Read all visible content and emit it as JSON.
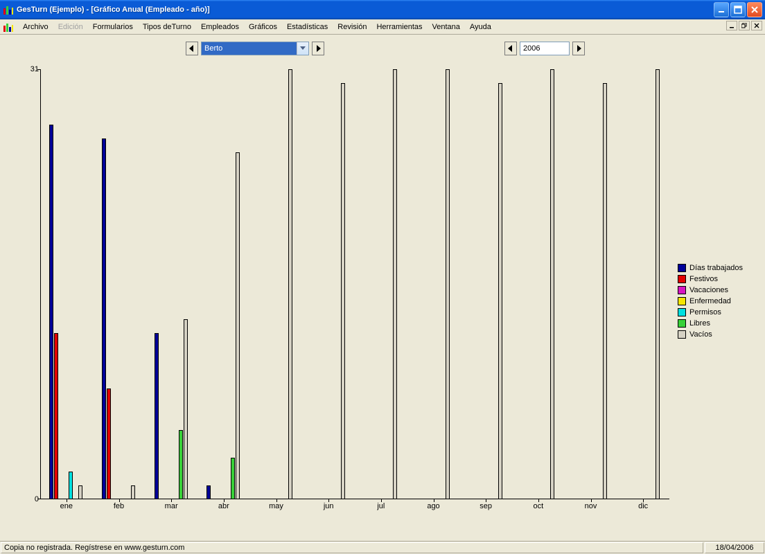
{
  "window": {
    "title": "GesTurn (Ejemplo) - [Gráfico Anual  (Empleado - año)]"
  },
  "menu": {
    "items": [
      "Archivo",
      "Edición",
      "Formularios",
      "Tipos deTurno",
      "Empleados",
      "Gráficos",
      "Estadísticas",
      "Revisión",
      "Herramientas",
      "Ventana",
      "Ayuda"
    ],
    "disabled_index": 1
  },
  "nav": {
    "employee": "Berto",
    "year": "2006"
  },
  "legend": {
    "items": [
      {
        "label": "Días trabajados",
        "color": "#000099"
      },
      {
        "label": "Festivos",
        "color": "#e30000"
      },
      {
        "label": "Vacaciones",
        "color": "#d815c3"
      },
      {
        "label": "Enfermedad",
        "color": "#f5e600"
      },
      {
        "label": "Permisos",
        "color": "#00e0e0"
      },
      {
        "label": "Libres",
        "color": "#38d138"
      },
      {
        "label": "Vacíos",
        "color": "#d6d2c4"
      }
    ]
  },
  "status": {
    "left": "Copia no registrada. Regístrese en www.gesturn.com",
    "right": "18/04/2006"
  },
  "chart_data": {
    "type": "bar",
    "title": "",
    "xlabel": "",
    "ylabel": "",
    "ylim": [
      0,
      31
    ],
    "yticks": [
      0,
      31
    ],
    "categories": [
      "ene",
      "feb",
      "mar",
      "abr",
      "may",
      "jun",
      "jul",
      "ago",
      "sep",
      "oct",
      "nov",
      "dic"
    ],
    "series": [
      {
        "name": "Días trabajados",
        "color": "#000099",
        "values": [
          27,
          26,
          12,
          1,
          0,
          0,
          0,
          0,
          0,
          0,
          0,
          0
        ]
      },
      {
        "name": "Festivos",
        "color": "#e30000",
        "values": [
          12,
          8,
          0,
          0,
          0,
          0,
          0,
          0,
          0,
          0,
          0,
          0
        ]
      },
      {
        "name": "Vacaciones",
        "color": "#d815c3",
        "values": [
          0,
          0,
          0,
          0,
          0,
          0,
          0,
          0,
          0,
          0,
          0,
          0
        ]
      },
      {
        "name": "Enfermedad",
        "color": "#f5e600",
        "values": [
          0,
          0,
          0,
          0,
          0,
          0,
          0,
          0,
          0,
          0,
          0,
          0
        ]
      },
      {
        "name": "Permisos",
        "color": "#00e0e0",
        "values": [
          2,
          0,
          0,
          0,
          0,
          0,
          0,
          0,
          0,
          0,
          0,
          0
        ]
      },
      {
        "name": "Libres",
        "color": "#38d138",
        "values": [
          0,
          0,
          5,
          3,
          0,
          0,
          0,
          0,
          0,
          0,
          0,
          0
        ]
      },
      {
        "name": "Vacíos",
        "color": "#d6d2c4",
        "values": [
          1,
          1,
          13,
          25,
          31,
          30,
          31,
          31,
          30,
          31,
          30,
          31
        ]
      }
    ]
  }
}
